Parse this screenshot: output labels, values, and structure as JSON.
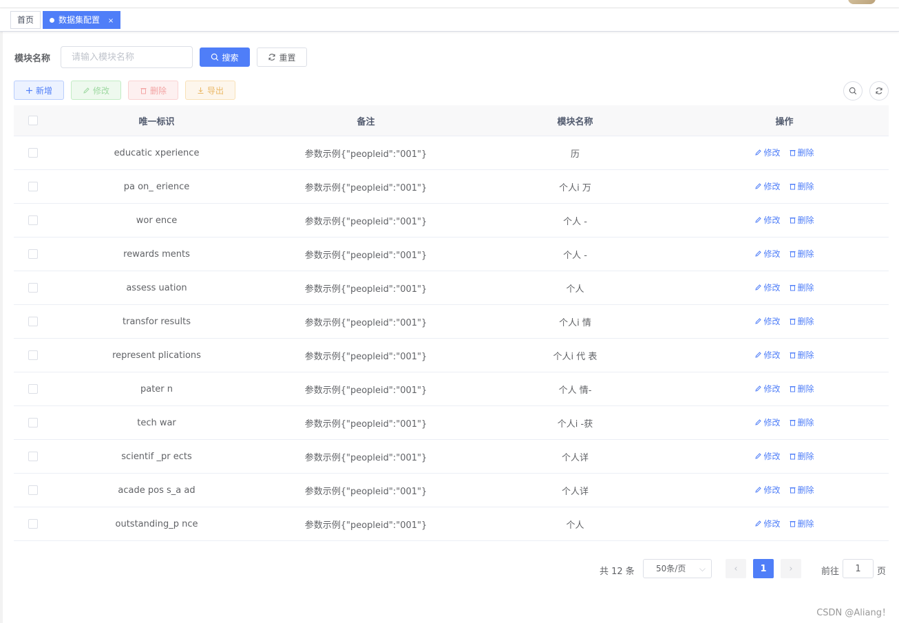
{
  "tags": {
    "home": "首页",
    "active": "数据集配置",
    "close": "×"
  },
  "query": {
    "label": "模块名称",
    "placeholder": "请输入模块名称",
    "search": "搜索",
    "reset": "重置"
  },
  "toolbar": {
    "add": "新增",
    "edit": "修改",
    "delete": "删除",
    "export": "导出"
  },
  "table": {
    "headers": [
      "唯一标识",
      "备注",
      "模块名称",
      "操作"
    ],
    "rows": [
      {
        "id": "educatic xperience",
        "remark": "参数示例{\"peopleid\":\"001\"}",
        "module": "历"
      },
      {
        "id": "pa on_ erience",
        "remark": "参数示例{\"peopleid\":\"001\"}",
        "module": "个人i 万"
      },
      {
        "id": "wor ence",
        "remark": "参数示例{\"peopleid\":\"001\"}",
        "module": "个人 -"
      },
      {
        "id": "rewards ments",
        "remark": "参数示例{\"peopleid\":\"001\"}",
        "module": "个人 -"
      },
      {
        "id": "assess uation",
        "remark": "参数示例{\"peopleid\":\"001\"}",
        "module": "个人"
      },
      {
        "id": "transfor results",
        "remark": "参数示例{\"peopleid\":\"001\"}",
        "module": "个人i 情"
      },
      {
        "id": "represent plications",
        "remark": "参数示例{\"peopleid\":\"001\"}",
        "module": "个人i 代 表"
      },
      {
        "id": "pater n",
        "remark": "参数示例{\"peopleid\":\"001\"}",
        "module": "个人 情-"
      },
      {
        "id": "tech war",
        "remark": "参数示例{\"peopleid\":\"001\"}",
        "module": "个人i -获"
      },
      {
        "id": "scientif _pr ects",
        "remark": "参数示例{\"peopleid\":\"001\"}",
        "module": "个人详"
      },
      {
        "id": "acade pos s_a ad",
        "remark": "参数示例{\"peopleid\":\"001\"}",
        "module": "个人详"
      },
      {
        "id": "outstanding_p nce",
        "remark": "参数示例{\"peopleid\":\"001\"}",
        "module": "个人"
      }
    ],
    "op_edit": "修改",
    "op_delete": "删除"
  },
  "pagination": {
    "total": "共 12 条",
    "page_size": "50条/页",
    "current_page": "1",
    "goto_label": "前往",
    "goto_value": "1",
    "goto_unit": "页"
  },
  "watermark": "CSDN @Aliang！",
  "colors": {
    "primary": "#4f7ef8",
    "success": "#9ed9a1",
    "danger": "#f3a4a4",
    "warning": "#eab764"
  }
}
